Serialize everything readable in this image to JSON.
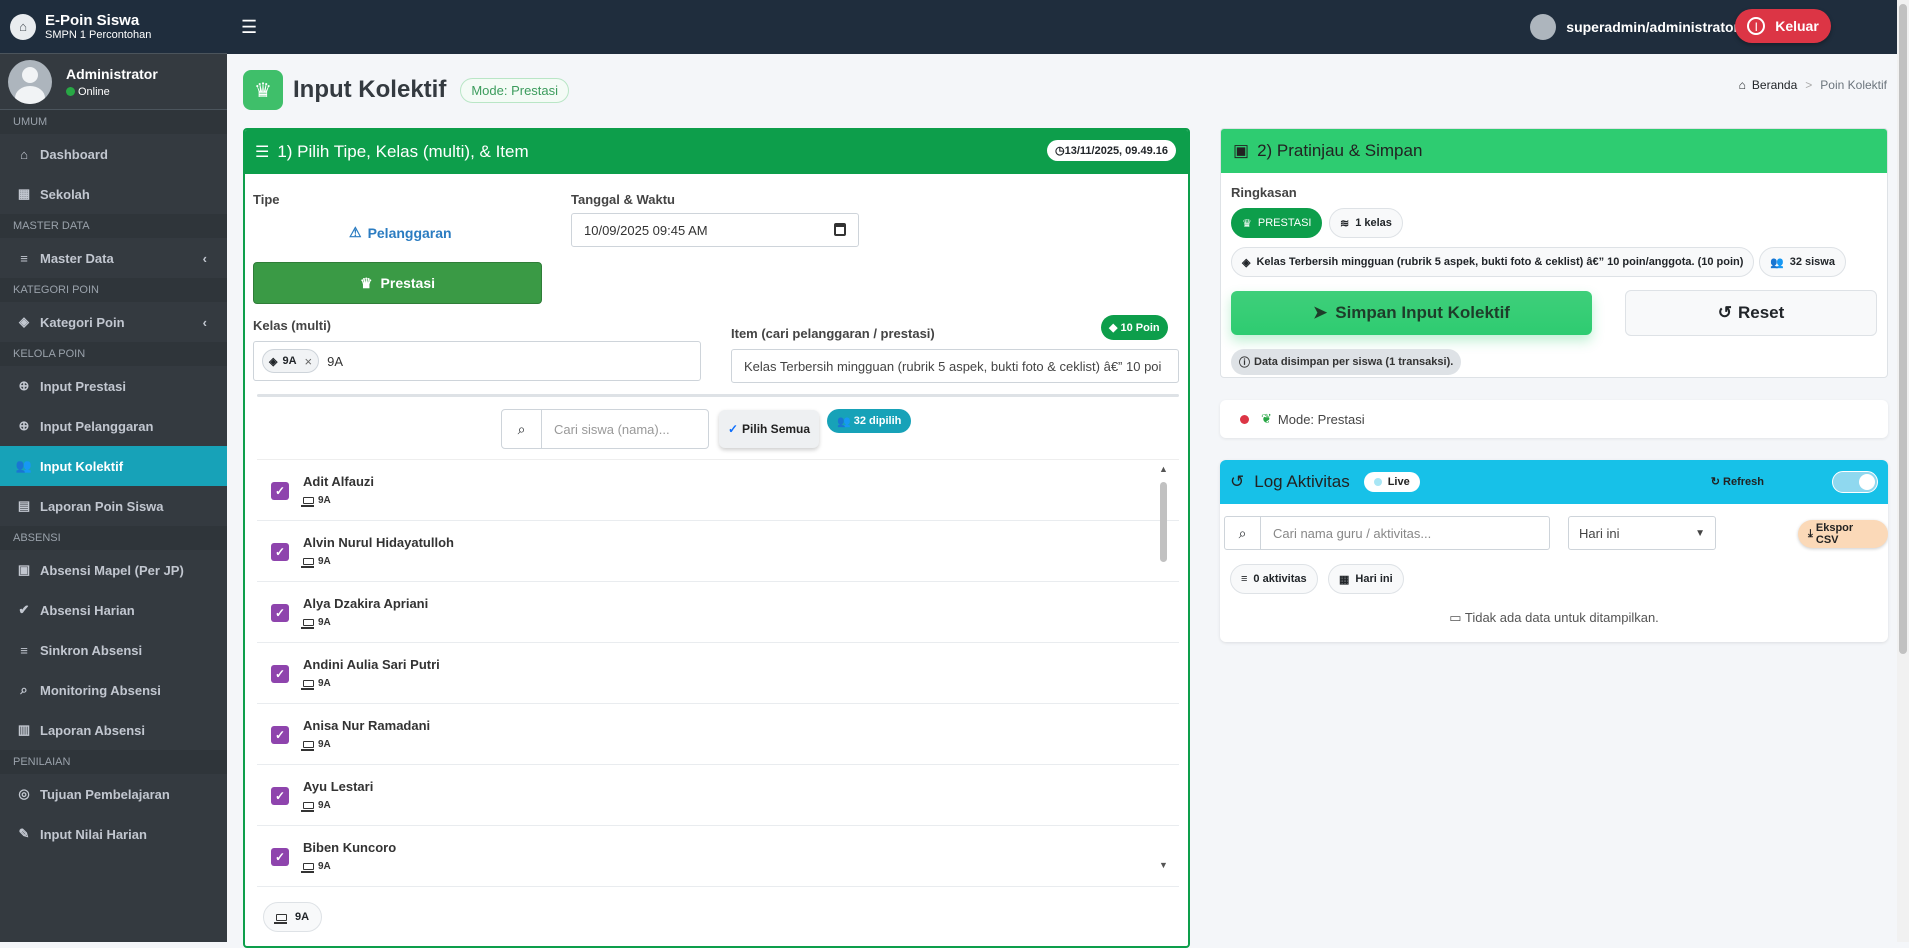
{
  "brand": {
    "title": "E-Poin Siswa",
    "subtitle": "SMPN 1 Percontohan"
  },
  "user": {
    "name": "Administrator",
    "status": "Online"
  },
  "sidebar": {
    "sections": [
      {
        "header": "UMUM",
        "items": [
          {
            "label": "Dashboard",
            "icon": "home-icon"
          },
          {
            "label": "Sekolah",
            "icon": "school-icon"
          }
        ]
      },
      {
        "header": "MASTER DATA",
        "items": [
          {
            "label": "Master Data",
            "icon": "database-icon"
          }
        ]
      },
      {
        "header": "KATEGORI POIN",
        "items": [
          {
            "label": "Kategori Poin",
            "icon": "tags-icon"
          }
        ]
      },
      {
        "header": "KELOLA POIN",
        "items": [
          {
            "label": "Input Prestasi",
            "icon": "plus-circle-icon"
          },
          {
            "label": "Input Pelanggaran",
            "icon": "plus-circle-icon"
          },
          {
            "label": "Input Kolektif",
            "icon": "users-icon"
          },
          {
            "label": "Laporan Poin Siswa",
            "icon": "file-icon"
          }
        ]
      },
      {
        "header": "ABSENSI",
        "items": [
          {
            "label": "Absensi Mapel (Per JP)",
            "icon": "chalkboard-icon"
          },
          {
            "label": "Absensi Harian",
            "icon": "user-check-icon"
          },
          {
            "label": "Sinkron Absensi",
            "icon": "database-icon"
          },
          {
            "label": "Monitoring Absensi",
            "icon": "search-icon"
          },
          {
            "label": "Laporan Absensi",
            "icon": "clipboard-icon"
          }
        ]
      },
      {
        "header": "PENILAIAN",
        "items": [
          {
            "label": "Tujuan Pembelajaran",
            "icon": "target-icon"
          },
          {
            "label": "Input Nilai Harian",
            "icon": "edit-icon"
          }
        ]
      }
    ]
  },
  "topbar": {
    "account": "superadmin/administrator",
    "logout": "Keluar"
  },
  "page": {
    "title": "Input Kolektif",
    "mode": "Mode: Prestasi",
    "breadcrumb_home": "Beranda",
    "breadcrumb_current": "Poin Kolektif"
  },
  "form": {
    "title": "1) Pilih Tipe, Kelas (multi), & Item",
    "timestamp": "13/11/2025, 09.49.16",
    "tipe_label": "Tipe",
    "tipe_pelanggaran": "Pelanggaran",
    "tipe_prestasi": "Prestasi",
    "datetime_label": "Tanggal & Waktu",
    "datetime_value": "10/09/2025 09:45 AM",
    "kelas_label": "Kelas (multi)",
    "kelas_chip": "9A",
    "kelas_typed": "9A",
    "item_label": "Item (cari pelanggaran / prestasi)",
    "poin_badge": "10 Poin",
    "item_value": "Kelas Terbersih mingguan (rubrik 5 aspek, bukti foto & ceklist) â€” 10 poi",
    "search_placeholder": "Cari siswa (nama)...",
    "select_all": "Pilih Semua",
    "selected_count": "32  dipilih",
    "footer_chip": "9A"
  },
  "students": [
    {
      "name": "Adit Alfauzi",
      "class": "9A",
      "checked": true
    },
    {
      "name": "Alvin Nurul Hidayatulloh",
      "class": "9A",
      "checked": true
    },
    {
      "name": "Alya Dzakira Apriani",
      "class": "9A",
      "checked": true
    },
    {
      "name": "Andini Aulia Sari Putri",
      "class": "9A",
      "checked": true
    },
    {
      "name": "Anisa Nur Ramadani",
      "class": "9A",
      "checked": true
    },
    {
      "name": "Ayu Lestari",
      "class": "9A",
      "checked": true
    },
    {
      "name": "Biben Kuncoro",
      "class": "9A",
      "checked": true
    }
  ],
  "preview": {
    "title": "2) Pratinjau & Simpan",
    "summary_label": "Ringkasan",
    "type_pill": "PRESTASI",
    "class_pill": "1 kelas",
    "item_pill": "Kelas Terbersih mingguan (rubrik 5 aspek, bukti foto & ceklist) â€” 10 poin/anggota. (10 poin)",
    "student_pill": "32 siswa",
    "save": "Simpan Input Kolektif",
    "reset": "Reset",
    "note": "Data disimpan per siswa (1 transaksi)."
  },
  "mode_card": {
    "text": "Mode: Prestasi"
  },
  "log": {
    "title": "Log Aktivitas",
    "live": "Live",
    "refresh": "Refresh",
    "search_placeholder": "Cari nama guru / aktivitas...",
    "period": "Hari ini",
    "export": "Ekspor CSV",
    "count": "0 aktivitas",
    "period_chip": "Hari ini",
    "empty": "Tidak ada data untuk ditampilkan."
  },
  "colors": {
    "primary_green": "#0d9e4b",
    "accent_green": "#2ecc71",
    "info": "#17a2b8",
    "danger": "#dc3545",
    "sidebar": "#343a40"
  }
}
